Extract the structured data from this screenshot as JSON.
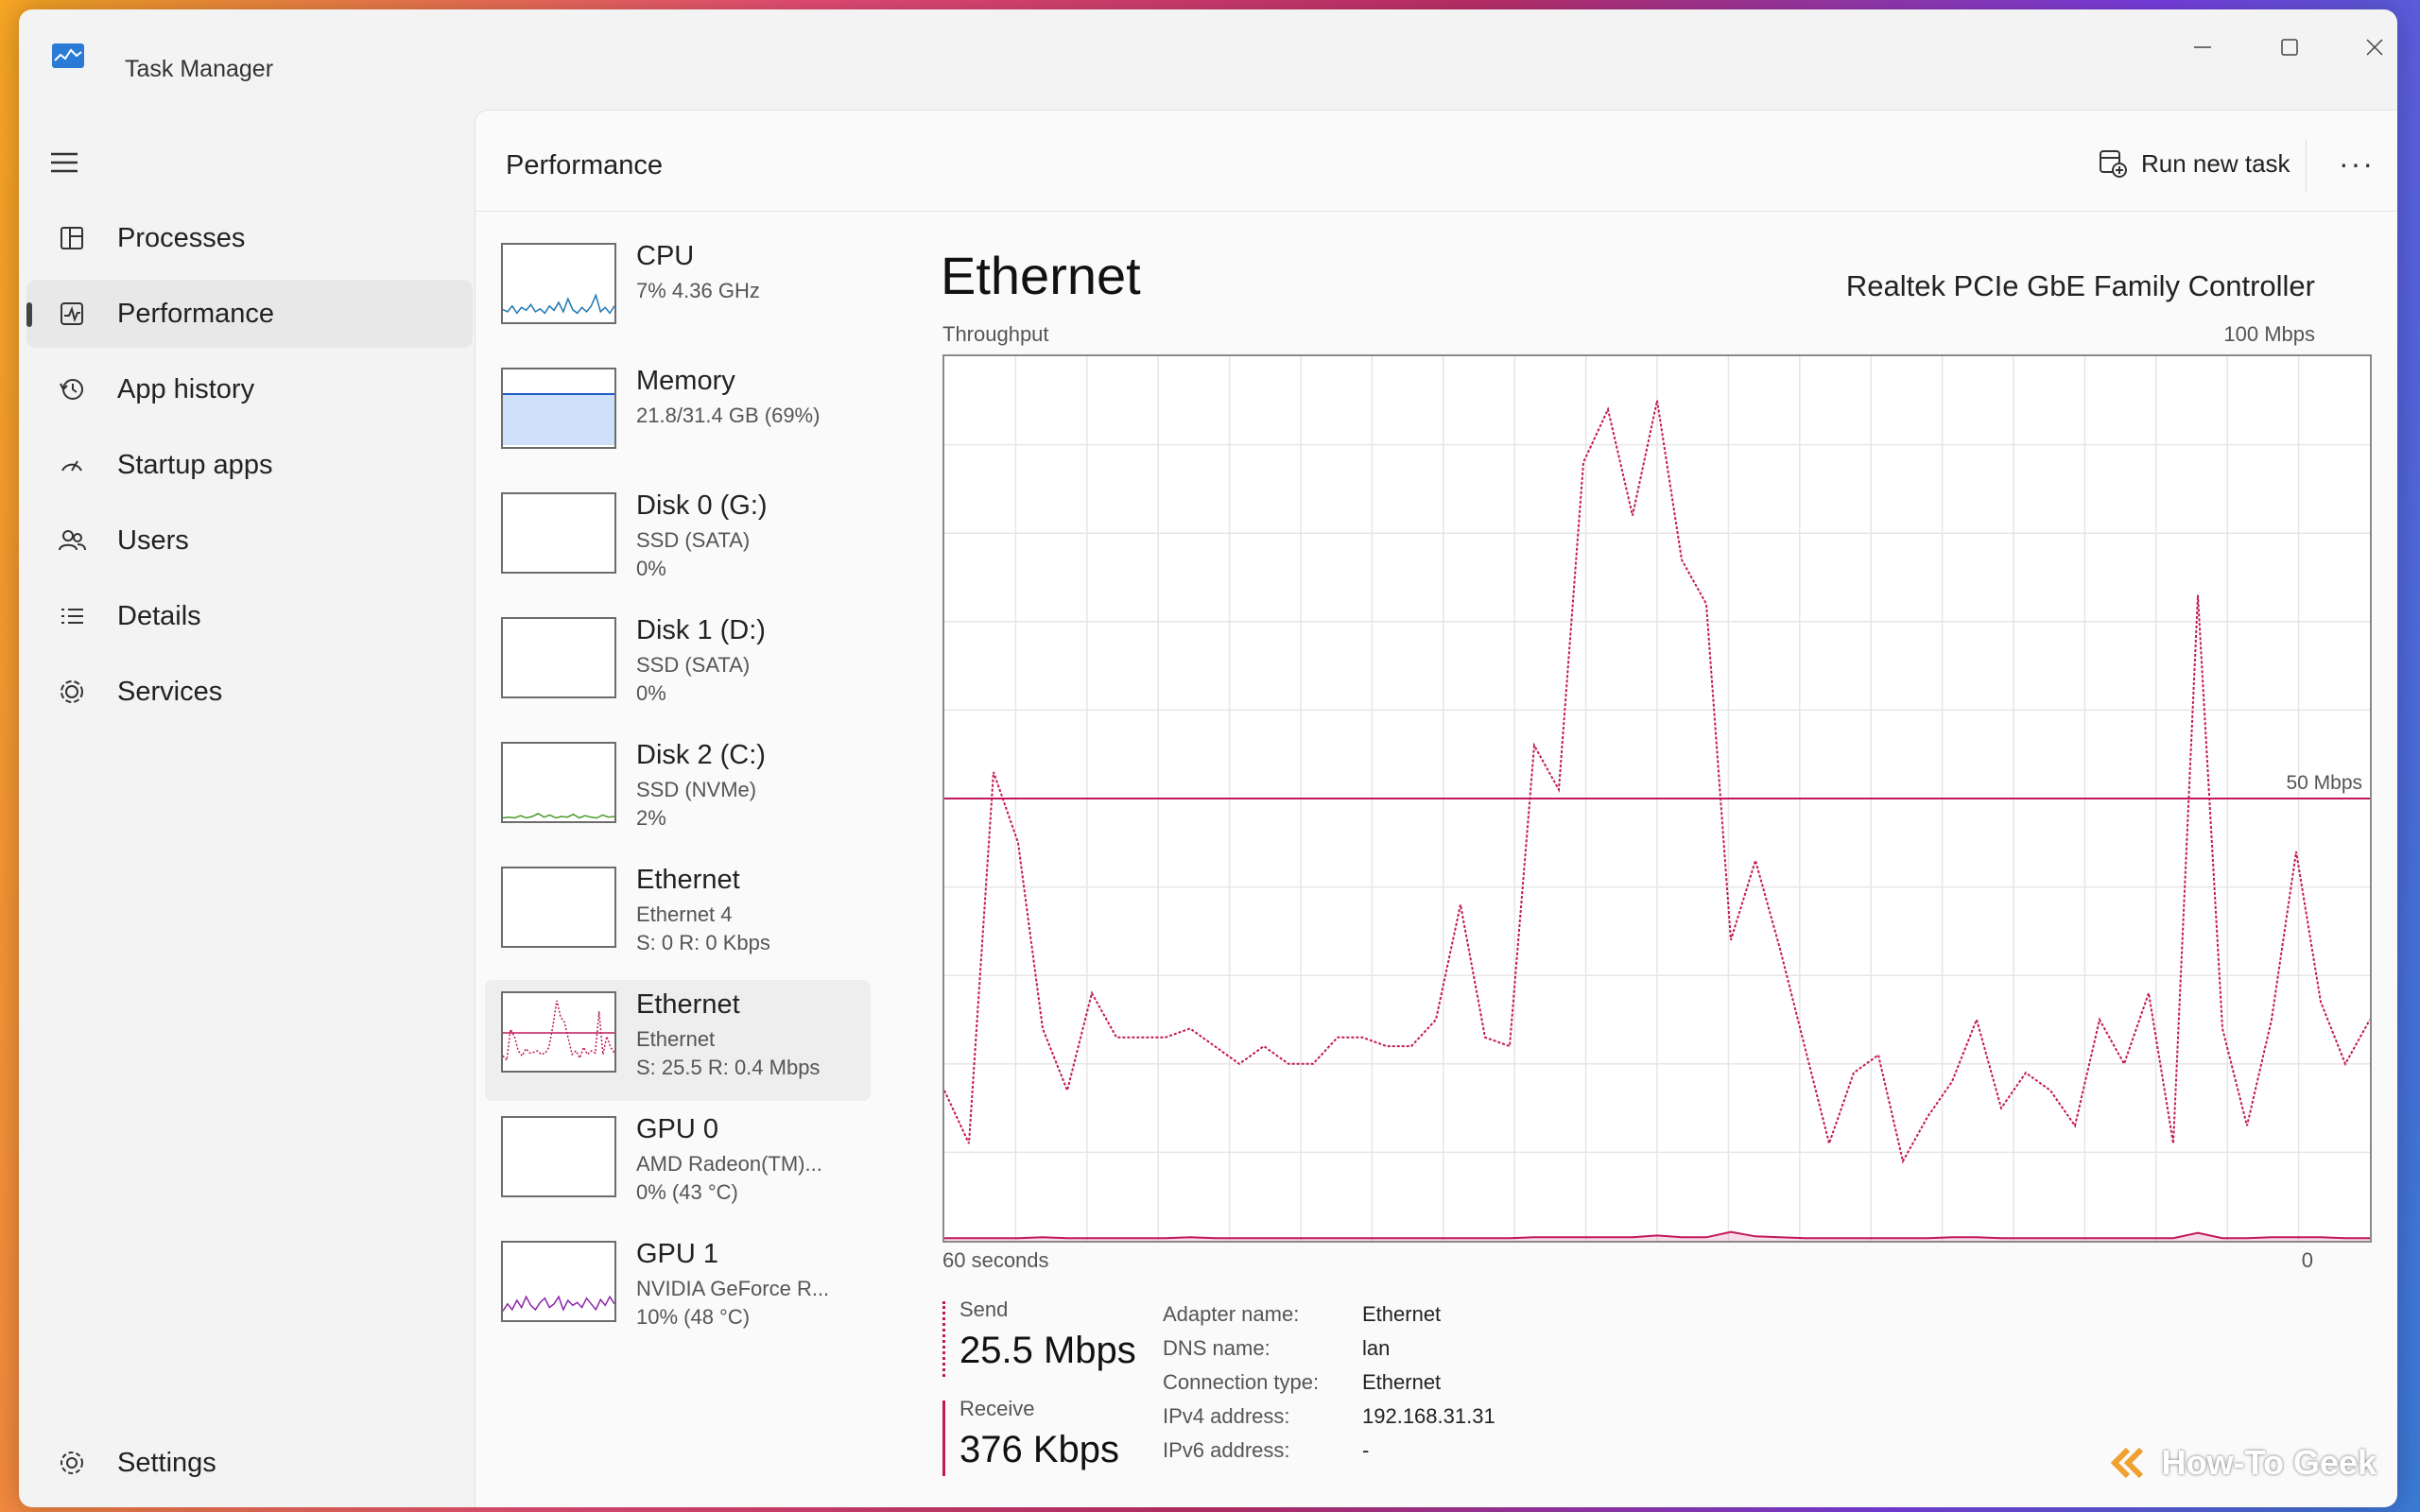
{
  "window": {
    "title": "Task Manager"
  },
  "sidebar": {
    "items": [
      {
        "label": "Processes",
        "icon": "processes-icon"
      },
      {
        "label": "Performance",
        "icon": "performance-icon",
        "active": true
      },
      {
        "label": "App history",
        "icon": "history-icon"
      },
      {
        "label": "Startup apps",
        "icon": "startup-icon"
      },
      {
        "label": "Users",
        "icon": "users-icon"
      },
      {
        "label": "Details",
        "icon": "details-icon"
      },
      {
        "label": "Services",
        "icon": "services-icon"
      }
    ],
    "settings_label": "Settings"
  },
  "header": {
    "title": "Performance",
    "run_task_label": "Run new task",
    "more_label": "···"
  },
  "devices": [
    {
      "name": "CPU",
      "sub1": "7% 4.36 GHz",
      "sub2": "",
      "color": "#1f78b4",
      "thumb": "line",
      "trace": [
        0.15,
        0.12,
        0.2,
        0.1,
        0.18,
        0.14,
        0.22,
        0.12,
        0.16,
        0.1,
        0.2,
        0.14,
        0.25,
        0.12,
        0.3,
        0.15,
        0.1,
        0.18,
        0.12,
        0.2,
        0.35,
        0.12,
        0.18,
        0.1,
        0.2
      ]
    },
    {
      "name": "Memory",
      "sub1": "21.8/31.4 GB (69%)",
      "sub2": "",
      "color": "#1f5fbf",
      "thumb": "fill",
      "fill": 0.69
    },
    {
      "name": "Disk 0 (G:)",
      "sub1": "SSD (SATA)",
      "sub2": "0%",
      "color": "#4c9a2a",
      "thumb": "empty"
    },
    {
      "name": "Disk 1 (D:)",
      "sub1": "SSD (SATA)",
      "sub2": "0%",
      "color": "#4c9a2a",
      "thumb": "empty"
    },
    {
      "name": "Disk 2 (C:)",
      "sub1": "SSD (NVMe)",
      "sub2": "2%",
      "color": "#4c9a2a",
      "thumb": "line",
      "trace": [
        0.02,
        0.03,
        0.02,
        0.05,
        0.02,
        0.04,
        0.08,
        0.03,
        0.06,
        0.02,
        0.04,
        0.03,
        0.07,
        0.02,
        0.05,
        0.03,
        0.02,
        0.06,
        0.03,
        0.04
      ]
    },
    {
      "name": "Ethernet",
      "sub1": "Ethernet 4",
      "sub2": "S: 0 R: 0 Kbps",
      "color": "#c2185b",
      "thumb": "empty"
    },
    {
      "name": "Ethernet",
      "sub1": "Ethernet",
      "sub2": "S: 25.5 R: 0.4 Mbps",
      "color": "#c2185b",
      "thumb": "line",
      "active": true,
      "trace": [
        0.18,
        0.12,
        0.55,
        0.45,
        0.25,
        0.18,
        0.28,
        0.22,
        0.23,
        0.25,
        0.2,
        0.22,
        0.3,
        0.6,
        0.95,
        0.72,
        0.65,
        0.42,
        0.2,
        0.25,
        0.15,
        0.3,
        0.2,
        0.25,
        0.22,
        0.8,
        0.2,
        0.45,
        0.3,
        0.22
      ]
    },
    {
      "name": "GPU 0",
      "sub1": "AMD Radeon(TM)...",
      "sub2": "0% (43 °C)",
      "color": "#8e24aa",
      "thumb": "empty"
    },
    {
      "name": "GPU 1",
      "sub1": "NVIDIA GeForce R...",
      "sub2": "10% (48 °C)",
      "color": "#8e24aa",
      "thumb": "line",
      "trace": [
        0.1,
        0.2,
        0.12,
        0.25,
        0.15,
        0.3,
        0.18,
        0.12,
        0.22,
        0.28,
        0.15,
        0.2,
        0.3,
        0.12,
        0.25,
        0.18,
        0.22,
        0.15,
        0.28,
        0.2,
        0.12,
        0.26,
        0.18,
        0.3,
        0.2
      ]
    }
  ],
  "detail": {
    "title": "Ethernet",
    "adapter": "Realtek PCIe GbE Family Controller",
    "graph_label_left": "Throughput",
    "graph_label_right": "100 Mbps",
    "graph_midline_label": "50 Mbps",
    "graph_x_left": "60 seconds",
    "graph_x_right": "0",
    "send_label": "Send",
    "send_value": "25.5 Mbps",
    "receive_label": "Receive",
    "receive_value": "376 Kbps",
    "info_keys": [
      "Adapter name:",
      "DNS name:",
      "Connection type:",
      "IPv4 address:",
      "IPv6 address:"
    ],
    "info_values": [
      "Ethernet",
      "lan",
      "Ethernet",
      "192.168.31.31",
      "-"
    ]
  },
  "colors": {
    "ethernet": "#c2185b",
    "grid": "#e6e6e6"
  },
  "watermark": "How-To Geek",
  "chart_data": {
    "type": "line",
    "ylim": [
      0,
      100
    ],
    "ylabel": "Throughput",
    "series": [
      {
        "name": "Send",
        "values": [
          17,
          11,
          53,
          45,
          24,
          17,
          28,
          23,
          23,
          23,
          24,
          22,
          20,
          22,
          20,
          20,
          23,
          23,
          22,
          22,
          25,
          38,
          23,
          22,
          56,
          51,
          88,
          94,
          82,
          95,
          77,
          72,
          34,
          43,
          33,
          22,
          11,
          19,
          21,
          9,
          14,
          18,
          25,
          15,
          19,
          17,
          13,
          25,
          20,
          28,
          11,
          73,
          24,
          13,
          25,
          44,
          27,
          20,
          25
        ],
        "style": "dotted"
      },
      {
        "name": "Receive",
        "values": [
          0.3,
          0.3,
          0.3,
          0.3,
          0.4,
          0.3,
          0.3,
          0.3,
          0.3,
          0.3,
          0.4,
          0.3,
          0.3,
          0.3,
          0.3,
          0.3,
          0.3,
          0.3,
          0.3,
          0.3,
          0.3,
          0.3,
          0.3,
          0.3,
          0.4,
          0.4,
          0.4,
          0.4,
          0.4,
          0.6,
          0.4,
          0.4,
          1,
          0.5,
          0.4,
          0.3,
          0.3,
          0.3,
          0.3,
          0.3,
          0.3,
          0.4,
          0.4,
          0.3,
          0.3,
          0.3,
          0.3,
          0.3,
          0.3,
          0.3,
          0.3,
          0.9,
          0.3,
          0.3,
          0.4,
          0.4,
          0.4,
          0.3,
          0.3
        ],
        "style": "solid"
      }
    ],
    "hline": 50,
    "grid": true
  }
}
